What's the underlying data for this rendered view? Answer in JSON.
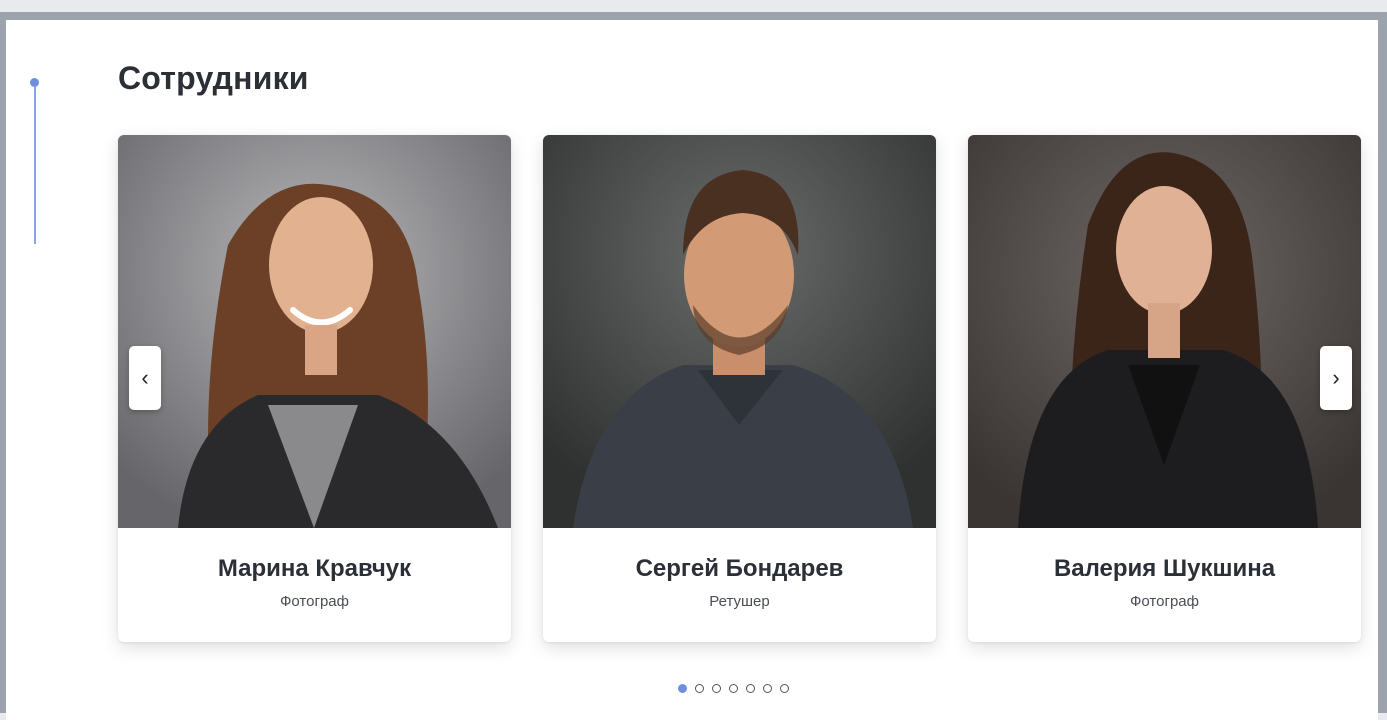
{
  "section": {
    "title": "Сотрудники"
  },
  "carousel": {
    "prev_label": "‹",
    "next_label": "›",
    "active_index": 0,
    "dot_count": 7
  },
  "employees": [
    {
      "name": "Марина Кравчук",
      "role": "Фотограф",
      "photo": "portrait-woman-smiling"
    },
    {
      "name": "Сергей Бондарев",
      "role": "Ретушер",
      "photo": "portrait-man"
    },
    {
      "name": "Валерия Шукшина",
      "role": "Фотограф",
      "photo": "portrait-woman"
    }
  ],
  "colors": {
    "accent": "#6f8fdc",
    "title": "#2b2f36"
  }
}
